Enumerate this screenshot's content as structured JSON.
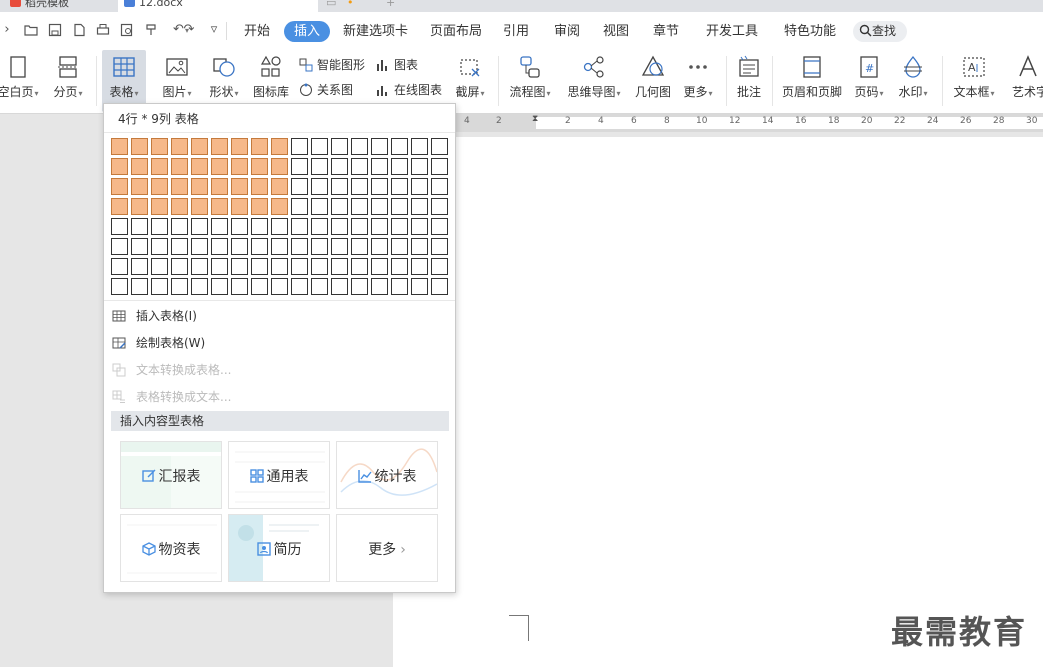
{
  "title_tabs": [
    {
      "label": "稻壳模板"
    },
    {
      "label": "12.docx"
    }
  ],
  "menu": {
    "tabs": [
      "开始",
      "插入",
      "新建选项卡",
      "页面布局",
      "引用",
      "审阅",
      "视图",
      "章节",
      "开发工具",
      "特色功能"
    ],
    "active_index": 1,
    "search_label": "查找"
  },
  "ribbon": {
    "buttons": [
      {
        "label": "空白页"
      },
      {
        "label": "分页"
      },
      {
        "label": "表格"
      },
      {
        "label": "图片"
      },
      {
        "label": "形状"
      },
      {
        "label": "图标库"
      },
      {
        "label": "截屏"
      },
      {
        "label": "流程图"
      },
      {
        "label": "思维导图"
      },
      {
        "label": "几何图"
      },
      {
        "label": "更多"
      },
      {
        "label": "批注"
      },
      {
        "label": "页眉和页脚"
      },
      {
        "label": "页码"
      },
      {
        "label": "水印"
      },
      {
        "label": "文本框"
      },
      {
        "label": "艺术字"
      }
    ],
    "small": [
      {
        "label": "智能图形"
      },
      {
        "label": "图表"
      },
      {
        "label": "关系图"
      },
      {
        "label": "在线图表"
      }
    ]
  },
  "ruler": {
    "numbers": [
      "4",
      "2",
      "2",
      "4",
      "6",
      "8",
      "10",
      "12",
      "14",
      "16",
      "18",
      "20",
      "22",
      "24",
      "26",
      "28",
      "30"
    ]
  },
  "table_dropdown": {
    "header": "4行 * 9列 表格",
    "grid": {
      "rows": 8,
      "cols": 17,
      "selected_rows": 4,
      "selected_cols": 9
    },
    "menu_items": [
      {
        "label": "插入表格(I)",
        "enabled": true
      },
      {
        "label": "绘制表格(W)",
        "enabled": true
      },
      {
        "label": "文本转换成表格...",
        "enabled": false
      },
      {
        "label": "表格转换成文本...",
        "enabled": false
      }
    ],
    "section_title": "插入内容型表格",
    "cards": [
      {
        "label": "汇报表"
      },
      {
        "label": "通用表"
      },
      {
        "label": "统计表"
      },
      {
        "label": "物资表"
      },
      {
        "label": "简历"
      },
      {
        "label": "更多"
      }
    ]
  },
  "watermark": "最需教育",
  "colors": {
    "accent": "#4a90e2",
    "grid_selected": "#f6b889",
    "icon_blue": "#4a90e2"
  }
}
